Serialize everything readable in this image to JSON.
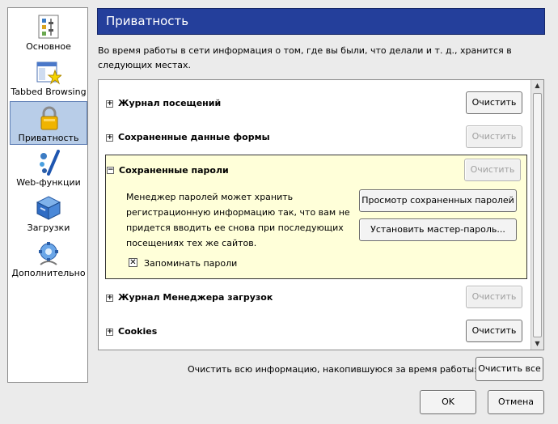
{
  "sidebar": {
    "items": [
      {
        "label": "Основное",
        "icon": "general-settings-icon"
      },
      {
        "label": "Tabbed Browsing",
        "icon": "tabbed-browsing-icon"
      },
      {
        "label": "Приватность",
        "icon": "lock-icon"
      },
      {
        "label": "Web-функции",
        "icon": "web-features-icon"
      },
      {
        "label": "Загрузки",
        "icon": "downloads-icon"
      },
      {
        "label": "Дополнительно",
        "icon": "advanced-icon"
      }
    ],
    "selected_index": 2
  },
  "header": {
    "title": "Приватность"
  },
  "intro": {
    "text": "Во время работы в сети информация о том, где вы были, что делали и т. д., хранится в следующих местах."
  },
  "panel": {
    "rows": [
      {
        "title": "Журнал посещений",
        "button": "Очистить",
        "enabled": true,
        "expander": "+"
      },
      {
        "title": "Сохраненные данные формы",
        "button": "Очистить",
        "enabled": false,
        "expander": "+"
      },
      {
        "title": "Сохраненные пароли",
        "button": "Очистить",
        "enabled": false,
        "expander": "−"
      },
      {
        "title": "Журнал Менеджера загрузок",
        "button": "Очистить",
        "enabled": false,
        "expander": "+"
      },
      {
        "title": "Cookies",
        "button": "Очистить",
        "enabled": true,
        "expander": "+"
      }
    ],
    "passwords": {
      "description": "Менеджер паролей может хранить регистрационную информацию так, что вам не придется вводить ее снова при последующих посещениях тех же сайтов.",
      "view_button": "Просмотр сохраненных паролей",
      "master_button": "Установить мастер-пароль...",
      "remember_label": "Запоминать пароли",
      "remember_checked": true,
      "check_mark": "✕"
    }
  },
  "footer": {
    "clear_all_label": "Очистить всю информацию, накопившуюся за время работы:",
    "clear_all_button": "Очистить все",
    "ok": "OK",
    "cancel": "Отмена"
  },
  "colors": {
    "header_bg": "#243f9b",
    "expanded_bg": "#ffffd9",
    "selected_bg": "#b8cde8"
  }
}
